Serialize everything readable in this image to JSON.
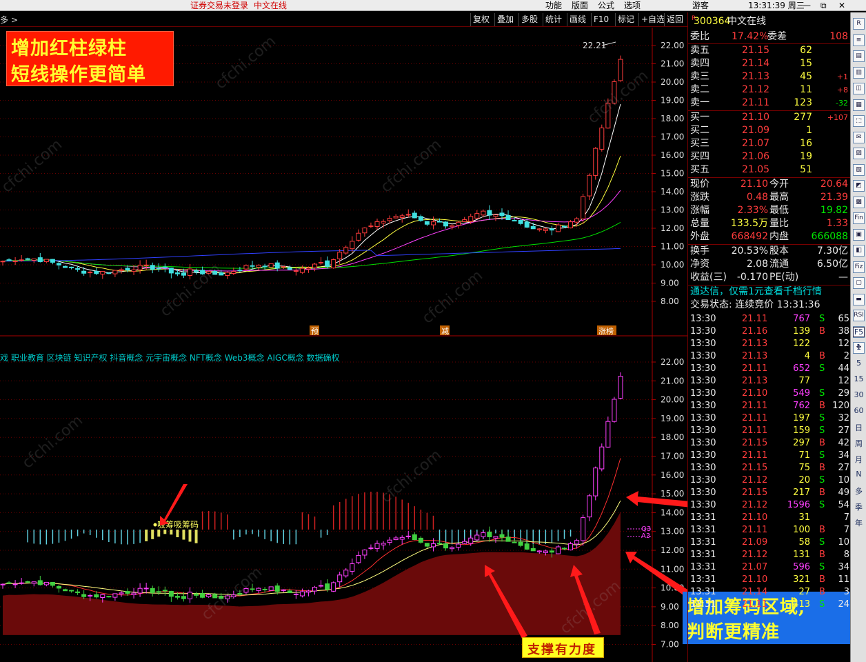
{
  "titlebar": {
    "login_status": "证券交易未登录",
    "stock_name": "中文在线",
    "menu": [
      "功能",
      "版面",
      "公式",
      "选项"
    ],
    "user": "游客",
    "clock": "13:31:39 周三"
  },
  "toolbar": {
    "left_label": "多 >",
    "buttons": [
      "复权",
      "叠加",
      "多股",
      "统计",
      "画线",
      "F10",
      "标记",
      "+自选",
      "返回"
    ]
  },
  "main_chart": {
    "y_ticks": [
      "22.00",
      "21.00",
      "20.00",
      "19.00",
      "18.00",
      "17.00",
      "16.00",
      "15.00",
      "14.00",
      "13.00",
      "12.00",
      "11.00",
      "10.00",
      "9.00",
      "8.00"
    ],
    "high_label": "22.21",
    "markers": [
      "预",
      "减",
      "涨榜"
    ],
    "watermark": "cfchi.com"
  },
  "sub_chart": {
    "concepts": "戏 职业教育 区块链 知识产权 抖音概念 元宇宙概念 NFT概念 Web3概念 AIGC概念 数据确权",
    "y_ticks": [
      "22.00",
      "21.00",
      "20.00",
      "19.00",
      "18.00",
      "17.00",
      "16.00",
      "15.00",
      "14.00",
      "13.00",
      "12.00",
      "11.00",
      "10.00",
      "9.00",
      "8.00",
      "7.00"
    ],
    "signal_label": "吸筹吸筹码",
    "right_tags": [
      "Q3",
      "A3"
    ]
  },
  "promos": {
    "top_left_line1": "增加红柱绿柱",
    "top_left_line2": "短线操作更简单",
    "bottom_right_line1": "增加筹码区域,",
    "bottom_right_line2": "判断更精准",
    "support_label": "支撑有力度"
  },
  "quote": {
    "code": "300364",
    "name": "中文在线",
    "weibi_label": "委比",
    "weibi": "17.42%",
    "weicha_label": "委差",
    "weicha": "108",
    "asks": [
      {
        "label": "卖五",
        "price": "21.15",
        "vol": "62",
        "chg": ""
      },
      {
        "label": "卖四",
        "price": "21.14",
        "vol": "15",
        "chg": ""
      },
      {
        "label": "卖三",
        "price": "21.13",
        "vol": "45",
        "chg": "+1"
      },
      {
        "label": "卖二",
        "price": "21.12",
        "vol": "11",
        "chg": "+8"
      },
      {
        "label": "卖一",
        "price": "21.11",
        "vol": "123",
        "chg": "-32"
      }
    ],
    "bids": [
      {
        "label": "买一",
        "price": "21.10",
        "vol": "277",
        "chg": "+107"
      },
      {
        "label": "买二",
        "price": "21.09",
        "vol": "1",
        "chg": ""
      },
      {
        "label": "买三",
        "price": "21.07",
        "vol": "16",
        "chg": ""
      },
      {
        "label": "买四",
        "price": "21.06",
        "vol": "19",
        "chg": ""
      },
      {
        "label": "买五",
        "price": "21.05",
        "vol": "51",
        "chg": ""
      }
    ],
    "stats": [
      {
        "l1": "现价",
        "v1": "21.10",
        "l2": "今开",
        "v2": "20.64"
      },
      {
        "l1": "涨跌",
        "v1": "0.48",
        "l2": "最高",
        "v2": "21.39"
      },
      {
        "l1": "涨幅",
        "v1": "2.33%",
        "l2": "最低",
        "v2": "19.82"
      },
      {
        "l1": "总量",
        "v1": "133.5万",
        "l2": "量比",
        "v2": "1.33"
      },
      {
        "l1": "外盘",
        "v1": "668492",
        "l2": "内盘",
        "v2": "666088"
      }
    ],
    "stats2": [
      {
        "l1": "换手",
        "v1": "20.53%",
        "l2": "股本",
        "v2": "7.30亿"
      },
      {
        "l1": "净资",
        "v1": "2.08",
        "l2": "流通",
        "v2": "6.50亿"
      },
      {
        "l1": "收益(三)",
        "v1": "-0.170",
        "l2": "PE(动)",
        "v2": "—"
      }
    ],
    "notice": "通达信，仅需1元查看千档行情",
    "trade_status": "交易状态: 连续竞价 13:31:36",
    "ticks": [
      {
        "t": "13:30",
        "p": "21.11",
        "v": "767",
        "s": "S",
        "n": "65"
      },
      {
        "t": "13:30",
        "p": "21.16",
        "v": "139",
        "s": "B",
        "n": "38"
      },
      {
        "t": "13:30",
        "p": "21.13",
        "v": "122",
        "s": "",
        "n": "12"
      },
      {
        "t": "13:30",
        "p": "21.13",
        "v": "4",
        "s": "B",
        "n": "2"
      },
      {
        "t": "13:30",
        "p": "21.11",
        "v": "652",
        "s": "S",
        "n": "44"
      },
      {
        "t": "13:30",
        "p": "21.13",
        "v": "77",
        "s": "",
        "n": "12"
      },
      {
        "t": "13:30",
        "p": "21.10",
        "v": "549",
        "s": "S",
        "n": "29"
      },
      {
        "t": "13:30",
        "p": "21.11",
        "v": "762",
        "s": "B",
        "n": "120"
      },
      {
        "t": "13:30",
        "p": "21.11",
        "v": "197",
        "s": "S",
        "n": "32"
      },
      {
        "t": "13:30",
        "p": "21.11",
        "v": "159",
        "s": "S",
        "n": "27"
      },
      {
        "t": "13:30",
        "p": "21.15",
        "v": "297",
        "s": "B",
        "n": "42"
      },
      {
        "t": "13:30",
        "p": "21.11",
        "v": "71",
        "s": "S",
        "n": "34"
      },
      {
        "t": "13:30",
        "p": "21.15",
        "v": "75",
        "s": "B",
        "n": "27"
      },
      {
        "t": "13:30",
        "p": "21.12",
        "v": "20",
        "s": "S",
        "n": "10"
      },
      {
        "t": "13:30",
        "p": "21.15",
        "v": "217",
        "s": "B",
        "n": "49"
      },
      {
        "t": "13:30",
        "p": "21.12",
        "v": "1596",
        "s": "S",
        "n": "54"
      },
      {
        "t": "13:31",
        "p": "21.10",
        "v": "31",
        "s": "",
        "n": "7"
      },
      {
        "t": "13:31",
        "p": "21.11",
        "v": "100",
        "s": "B",
        "n": "7"
      },
      {
        "t": "13:31",
        "p": "21.09",
        "v": "58",
        "s": "S",
        "n": "10"
      },
      {
        "t": "13:31",
        "p": "21.12",
        "v": "131",
        "s": "B",
        "n": "8"
      },
      {
        "t": "13:31",
        "p": "21.07",
        "v": "596",
        "s": "S",
        "n": "34"
      },
      {
        "t": "13:31",
        "p": "21.10",
        "v": "321",
        "s": "B",
        "n": "11"
      },
      {
        "t": "13:31",
        "p": "21.14",
        "v": "27",
        "s": "B",
        "n": "3"
      },
      {
        "t": "13:31",
        "p": "21.11",
        "v": "413",
        "s": "S",
        "n": "24"
      }
    ]
  },
  "sidebar": {
    "icons": [
      "R",
      "≡",
      "▤",
      "▥",
      "◫",
      "▦",
      "⬚",
      "✉",
      "▧",
      "▨",
      "◩",
      "▩",
      "Fin",
      "▣",
      "◧",
      "Fiz",
      "▢",
      "▬",
      "RSI",
      "◆",
      "✥"
    ],
    "periods": [
      "F5",
      "1",
      "5",
      "15",
      "30",
      "60",
      "日",
      "周",
      "月",
      "N",
      "多",
      "季",
      "年"
    ]
  }
}
